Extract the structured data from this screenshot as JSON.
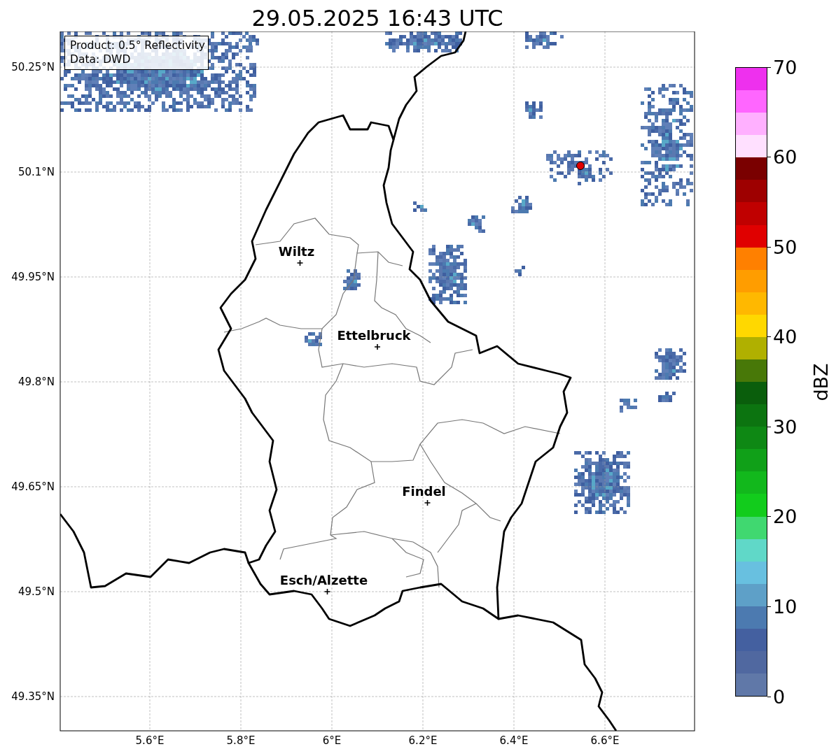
{
  "title": "29.05.2025 16:43 UTC",
  "legend": [
    "Product: 0.5° Reflectivity",
    "Data: DWD"
  ],
  "map": {
    "lat_labels": [
      "50.25°N",
      "50.1°N",
      "49.95°N",
      "49.8°N",
      "49.65°N",
      "49.5°N",
      "49.35°N"
    ],
    "lon_labels": [
      "5.6°E",
      "5.8°E",
      "6°E",
      "6.2°E",
      "6.4°E",
      "6.6°E"
    ],
    "cities": [
      {
        "name": "Wiltz"
      },
      {
        "name": "Ettelbruck"
      },
      {
        "name": "Findel"
      },
      {
        "name": "Esch/Alzette"
      }
    ]
  },
  "colorbar": {
    "label": "dBZ",
    "ticks": [
      "70",
      "60",
      "50",
      "40",
      "30",
      "20",
      "10",
      "0"
    ],
    "bands": [
      {
        "color": "#ee30ee"
      },
      {
        "color": "#ff66ff"
      },
      {
        "color": "#ffb0ff"
      },
      {
        "color": "#ffe0ff"
      },
      {
        "color": "#7a0000"
      },
      {
        "color": "#9e0000"
      },
      {
        "color": "#c00000"
      },
      {
        "color": "#e00000"
      },
      {
        "color": "#ff8000"
      },
      {
        "color": "#ff9d00"
      },
      {
        "color": "#ffb800"
      },
      {
        "color": "#ffd800"
      },
      {
        "color": "#b0b000"
      },
      {
        "color": "#487808"
      },
      {
        "color": "#0a5e0c"
      },
      {
        "color": "#0c7410"
      },
      {
        "color": "#0e8814"
      },
      {
        "color": "#10a018"
      },
      {
        "color": "#12b81c"
      },
      {
        "color": "#12cc1c"
      },
      {
        "color": "#40d870"
      },
      {
        "color": "#60d8c8"
      },
      {
        "color": "#68c0e0"
      },
      {
        "color": "#5ea0c8"
      },
      {
        "color": "#4c7ab0"
      },
      {
        "color": "#4460a0"
      },
      {
        "color": "#5068a0"
      },
      {
        "color": "#6078a8"
      }
    ]
  }
}
